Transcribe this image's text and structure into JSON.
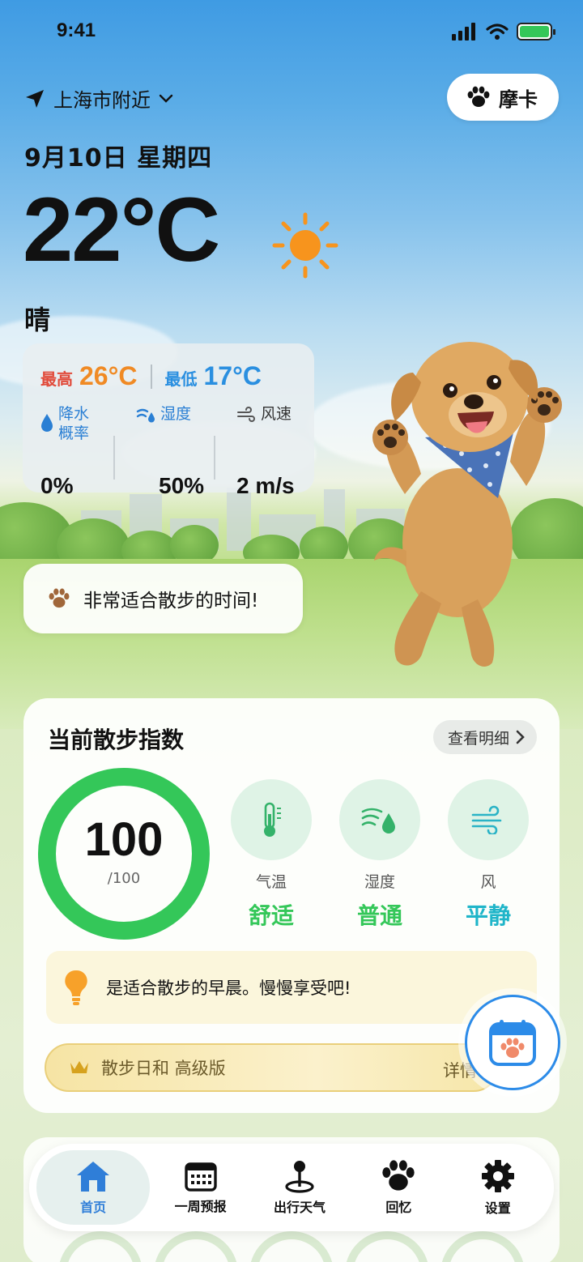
{
  "status_bar": {
    "time": "9:41"
  },
  "header": {
    "location": "上海市附近",
    "pet_name": "摩卡",
    "date": "9月10日 星期四"
  },
  "weather": {
    "temperature": "22°C",
    "condition": "晴",
    "high_label": "最高",
    "high_value": "26°C",
    "low_label": "最低",
    "low_value": "17°C",
    "precip_label": "降水\n概率",
    "precip_value": "0%",
    "humidity_label": "湿度",
    "humidity_value": "50%",
    "wind_label": "风速",
    "wind_value": "2 m/s"
  },
  "walk_message": "非常适合散步的时间!",
  "walk_index": {
    "title": "当前散步指数",
    "detail_button": "查看明细",
    "score": "100",
    "max": "/100",
    "score_fraction": 1.0,
    "factors": [
      {
        "label": "气温",
        "status": "舒适",
        "icon": "thermometer-icon",
        "color": "#34c759"
      },
      {
        "label": "湿度",
        "status": "普通",
        "icon": "humidity-drop-icon",
        "color": "#34c759"
      },
      {
        "label": "风",
        "status": "平静",
        "icon": "wind-icon",
        "color": "#1fb5c9"
      }
    ],
    "tip": "是适合散步的早晨。慢慢享受吧!",
    "premium_label": "散步日和 高级版",
    "premium_more": "详情"
  },
  "colors": {
    "accent": "#2f7ed8",
    "good": "#34c759",
    "high": "#f08a24",
    "low": "#2a8fe0"
  },
  "tabs": [
    {
      "label": "首页",
      "icon": "home-icon",
      "active": true
    },
    {
      "label": "一周预报",
      "icon": "calendar-grid-icon",
      "active": false
    },
    {
      "label": "出行天气",
      "icon": "map-pin-icon",
      "active": false
    },
    {
      "label": "回忆",
      "icon": "paw-icon",
      "active": false
    },
    {
      "label": "设置",
      "icon": "gear-icon",
      "active": false
    }
  ]
}
